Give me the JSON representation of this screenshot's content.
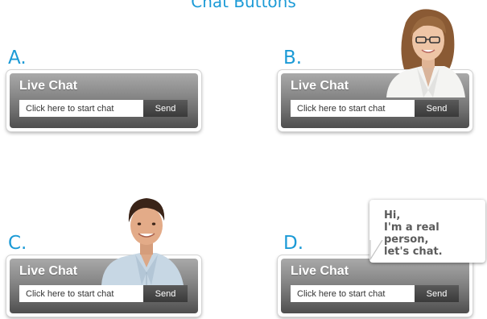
{
  "page": {
    "title": "Chat Buttons",
    "accent_color": "#1b9ad6"
  },
  "variants": [
    {
      "label": "A.",
      "widget": {
        "title": "Live Chat",
        "input_placeholder": "Click here to start chat",
        "send_label": "Send"
      }
    },
    {
      "label": "B.",
      "widget": {
        "title": "Live Chat",
        "input_placeholder": "Click here to start chat",
        "send_label": "Send"
      },
      "decoration": "woman-photo"
    },
    {
      "label": "C.",
      "widget": {
        "title": "Live Chat",
        "input_placeholder": "Click here to start chat",
        "send_label": "Send"
      },
      "decoration": "man-photo"
    },
    {
      "label": "D.",
      "widget": {
        "title": "Live Chat",
        "input_placeholder": "Click here to start chat",
        "send_label": "Send"
      },
      "decoration": "speech-bubble",
      "bubble": {
        "line1": "Hi,",
        "line2": "I'm a real person,",
        "line3": "let's chat."
      }
    }
  ]
}
